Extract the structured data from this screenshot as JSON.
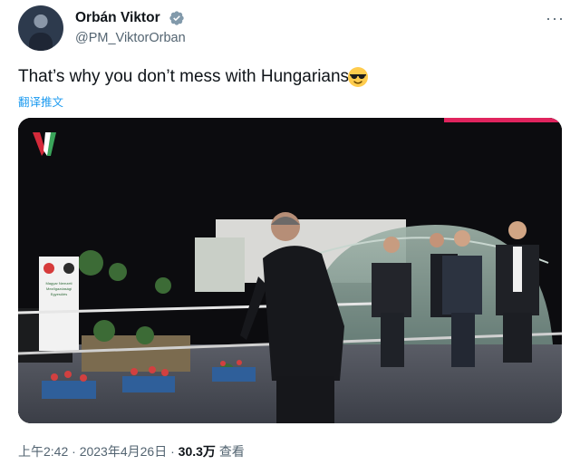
{
  "author": {
    "name": "Orbán Viktor",
    "handle": "@PM_ViktorOrban"
  },
  "tweet": {
    "text": "That’s why you don’t mess with Hungarians",
    "emoji": "sunglasses-emoji",
    "translate_label": "翻译推文"
  },
  "media": {
    "sign_lines": [
      "Magyar Nemzeti",
      "Mezőgazdasági",
      "Egyesülés"
    ],
    "watermark": "V"
  },
  "meta": {
    "time": "上午2:42",
    "separator": "·",
    "date": "2023年4月26日",
    "views_count": "30.3万",
    "views_label": "查看"
  },
  "colors": {
    "accent": "#1d9bf0",
    "verified": "#829aab",
    "media_top_bar": "#e0245e",
    "media_bottom_bar": "#3fbf7f"
  }
}
